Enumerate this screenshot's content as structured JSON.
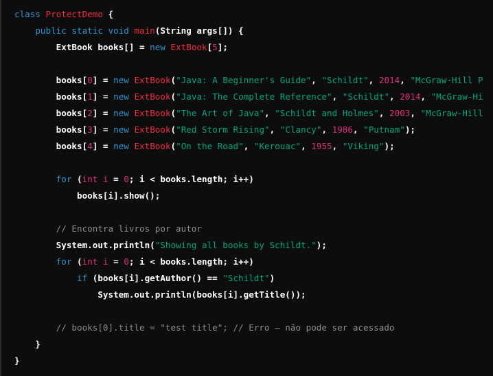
{
  "colors": {
    "background": "#0d0d0d",
    "keyword": "#2e95d3",
    "class_name": "#f22c3d",
    "string": "#00a67d",
    "number": "#df3079",
    "comment": "#8c8c8c",
    "plain": "#ffffff"
  },
  "lines": [
    {
      "indent": 0,
      "tokens": [
        [
          "k",
          "class "
        ],
        [
          "c",
          "ProtectDemo"
        ],
        [
          "p",
          " {"
        ]
      ]
    },
    {
      "indent": 1,
      "tokens": [
        [
          "k",
          "public static void "
        ],
        [
          "c",
          "main"
        ],
        [
          "p",
          "(String args[]) {"
        ]
      ]
    },
    {
      "indent": 2,
      "tokens": [
        [
          "p",
          "ExtBook books[] = "
        ],
        [
          "k",
          "new "
        ],
        [
          "c",
          "ExtBook"
        ],
        [
          "p",
          "["
        ],
        [
          "n",
          "5"
        ],
        [
          "p",
          "];"
        ]
      ]
    },
    {
      "indent": 0,
      "tokens": []
    },
    {
      "indent": 2,
      "tokens": [
        [
          "p",
          "books["
        ],
        [
          "n",
          "0"
        ],
        [
          "p",
          "] = "
        ],
        [
          "k",
          "new "
        ],
        [
          "c",
          "ExtBook"
        ],
        [
          "p",
          "("
        ],
        [
          "s",
          "\"Java: A Beginner's Guide\""
        ],
        [
          "p",
          ", "
        ],
        [
          "s",
          "\"Schildt\""
        ],
        [
          "p",
          ", "
        ],
        [
          "n",
          "2014"
        ],
        [
          "p",
          ", "
        ],
        [
          "s",
          "\"McGraw-Hill P"
        ]
      ]
    },
    {
      "indent": 2,
      "tokens": [
        [
          "p",
          "books["
        ],
        [
          "n",
          "1"
        ],
        [
          "p",
          "] = "
        ],
        [
          "k",
          "new "
        ],
        [
          "c",
          "ExtBook"
        ],
        [
          "p",
          "("
        ],
        [
          "s",
          "\"Java: The Complete Reference\""
        ],
        [
          "p",
          ", "
        ],
        [
          "s",
          "\"Schildt\""
        ],
        [
          "p",
          ", "
        ],
        [
          "n",
          "2014"
        ],
        [
          "p",
          ", "
        ],
        [
          "s",
          "\"McGraw-Hi"
        ]
      ]
    },
    {
      "indent": 2,
      "tokens": [
        [
          "p",
          "books["
        ],
        [
          "n",
          "2"
        ],
        [
          "p",
          "] = "
        ],
        [
          "k",
          "new "
        ],
        [
          "c",
          "ExtBook"
        ],
        [
          "p",
          "("
        ],
        [
          "s",
          "\"The Art of Java\""
        ],
        [
          "p",
          ", "
        ],
        [
          "s",
          "\"Schildt and Holmes\""
        ],
        [
          "p",
          ", "
        ],
        [
          "n",
          "2003"
        ],
        [
          "p",
          ", "
        ],
        [
          "s",
          "\"McGraw-Hill"
        ]
      ]
    },
    {
      "indent": 2,
      "tokens": [
        [
          "p",
          "books["
        ],
        [
          "n",
          "3"
        ],
        [
          "p",
          "] = "
        ],
        [
          "k",
          "new "
        ],
        [
          "c",
          "ExtBook"
        ],
        [
          "p",
          "("
        ],
        [
          "s",
          "\"Red Storm Rising\""
        ],
        [
          "p",
          ", "
        ],
        [
          "s",
          "\"Clancy\""
        ],
        [
          "p",
          ", "
        ],
        [
          "n",
          "1986"
        ],
        [
          "p",
          ", "
        ],
        [
          "s",
          "\"Putnam\""
        ],
        [
          "p",
          ");"
        ]
      ]
    },
    {
      "indent": 2,
      "tokens": [
        [
          "p",
          "books["
        ],
        [
          "n",
          "4"
        ],
        [
          "p",
          "] = "
        ],
        [
          "k",
          "new "
        ],
        [
          "c",
          "ExtBook"
        ],
        [
          "p",
          "("
        ],
        [
          "s",
          "\"On the Road\""
        ],
        [
          "p",
          ", "
        ],
        [
          "s",
          "\"Kerouac\""
        ],
        [
          "p",
          ", "
        ],
        [
          "n",
          "1955"
        ],
        [
          "p",
          ", "
        ],
        [
          "s",
          "\"Viking\""
        ],
        [
          "p",
          ");"
        ]
      ]
    },
    {
      "indent": 0,
      "tokens": []
    },
    {
      "indent": 2,
      "tokens": [
        [
          "k",
          "for "
        ],
        [
          "p",
          "("
        ],
        [
          "n",
          "int i"
        ],
        [
          "p",
          " = "
        ],
        [
          "n",
          "0"
        ],
        [
          "p",
          "; i < books.length; i++)"
        ]
      ]
    },
    {
      "indent": 3,
      "tokens": [
        [
          "p",
          "books[i].show();"
        ]
      ]
    },
    {
      "indent": 0,
      "tokens": []
    },
    {
      "indent": 2,
      "tokens": [
        [
          "m",
          "// Encontra livros por autor"
        ]
      ]
    },
    {
      "indent": 2,
      "tokens": [
        [
          "p",
          "System.out.println("
        ],
        [
          "s",
          "\"Showing all books by Schildt.\""
        ],
        [
          "p",
          ");"
        ]
      ]
    },
    {
      "indent": 2,
      "tokens": [
        [
          "k",
          "for "
        ],
        [
          "p",
          "("
        ],
        [
          "n",
          "int i"
        ],
        [
          "p",
          " = "
        ],
        [
          "n",
          "0"
        ],
        [
          "p",
          "; i < books.length; i++)"
        ]
      ]
    },
    {
      "indent": 3,
      "tokens": [
        [
          "k",
          "if "
        ],
        [
          "p",
          "(books[i].getAuthor() == "
        ],
        [
          "s",
          "\"Schildt\""
        ],
        [
          "p",
          ")"
        ]
      ]
    },
    {
      "indent": 4,
      "tokens": [
        [
          "p",
          "System.out.println(books[i].getTitle());"
        ]
      ]
    },
    {
      "indent": 0,
      "tokens": []
    },
    {
      "indent": 2,
      "tokens": [
        [
          "m",
          "// books[0].title = \"test title\"; // Erro – não pode ser acessado"
        ]
      ]
    },
    {
      "indent": 1,
      "tokens": [
        [
          "p",
          "}"
        ]
      ]
    },
    {
      "indent": 0,
      "tokens": [
        [
          "p",
          "}"
        ]
      ]
    }
  ]
}
